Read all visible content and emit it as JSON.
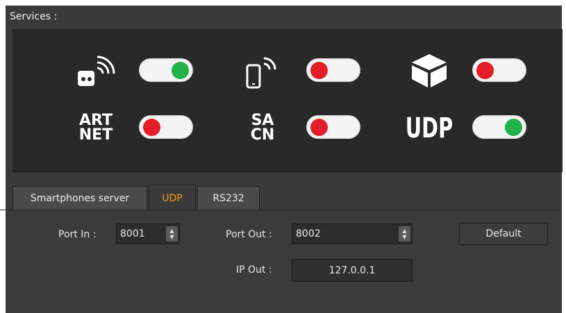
{
  "services": {
    "title": "Services :",
    "items": [
      {
        "name": "Remote",
        "state": "on",
        "icon": "remote-wifi-icon"
      },
      {
        "name": "Smartphone",
        "state": "off",
        "icon": "phone-wifi-icon"
      },
      {
        "name": "Box",
        "state": "off",
        "icon": "cube-icon"
      },
      {
        "name": "Art-Net",
        "state": "off",
        "icon_text_1": "ART",
        "icon_text_2": "NET"
      },
      {
        "name": "sACN",
        "state": "off",
        "icon_text_1": "SA",
        "icon_text_2": "CN"
      },
      {
        "name": "UDP",
        "state": "on",
        "icon_text_1": "UDP"
      }
    ],
    "colors": {
      "on": "#21b24a",
      "off": "#e31e28"
    }
  },
  "tabs": [
    {
      "label": "Smartphones server",
      "active": false
    },
    {
      "label": "UDP",
      "active": true
    },
    {
      "label": "RS232",
      "active": false
    }
  ],
  "udp": {
    "port_in_label": "Port In :",
    "port_in_value": "8001",
    "port_out_label": "Port Out :",
    "port_out_value": "8002",
    "default_label": "Default",
    "ip_out_label": "IP Out :",
    "ip_out_value": "127.0.0.1"
  }
}
